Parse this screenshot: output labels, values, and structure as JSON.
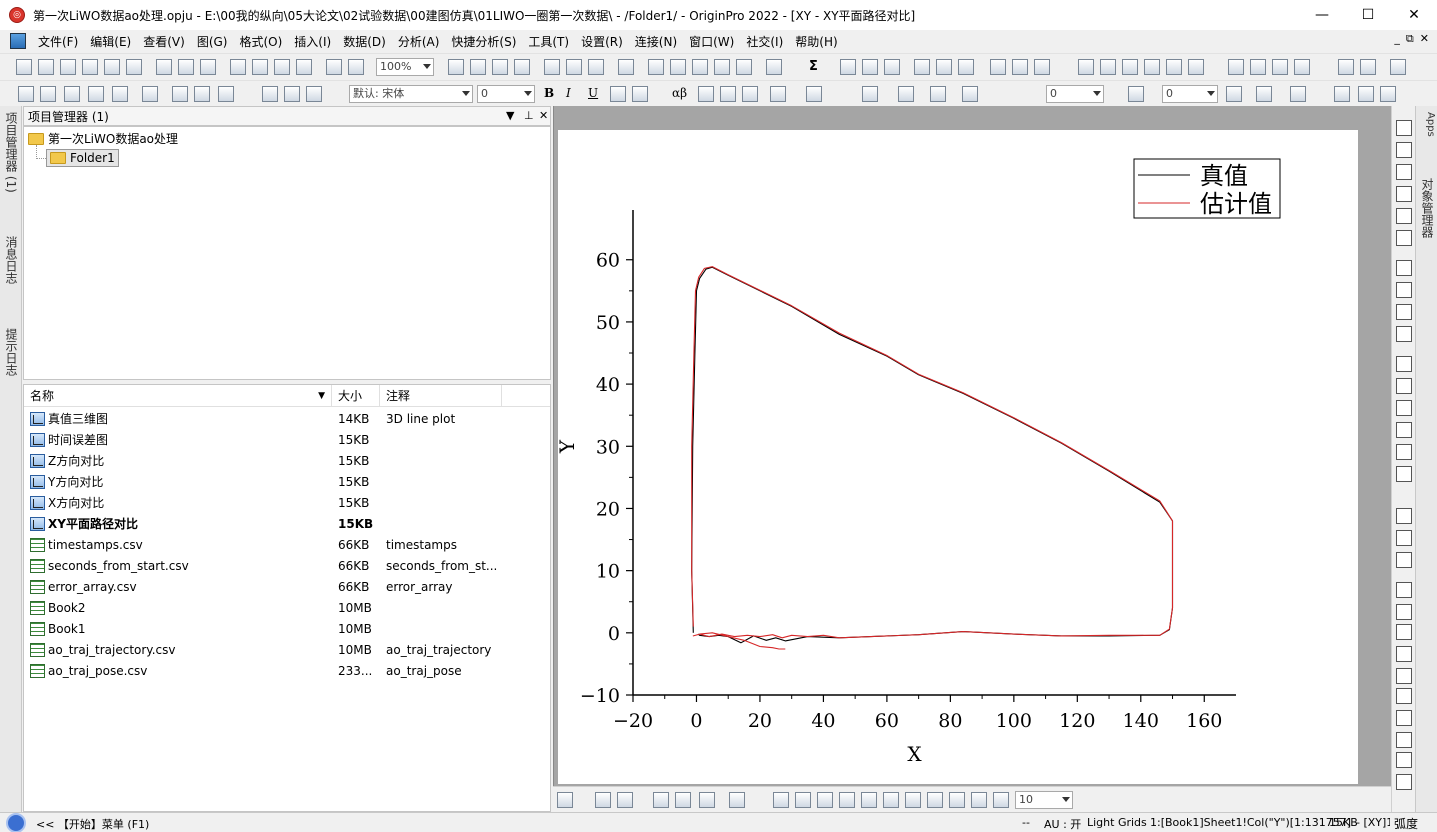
{
  "window": {
    "title": "第一次LiWO数据ao处理.opju - E:\\00我的纵向\\05大论文\\02试验数据\\00建图仿真\\01LIWO一圈第一次数据\\ - /Folder1/ - OriginPro 2022 - [XY - XY平面路径对比]",
    "minimize": "—",
    "maximize": "☐",
    "close": "✕"
  },
  "menubar": {
    "items": [
      "文件(F)",
      "编辑(E)",
      "查看(V)",
      "图(G)",
      "格式(O)",
      "插入(I)",
      "数据(D)",
      "分析(A)",
      "快捷分析(S)",
      "工具(T)",
      "设置(R)",
      "连接(N)",
      "窗口(W)",
      "社交(I)",
      "帮助(H)"
    ],
    "mdi_controls": [
      "_",
      "⧉",
      "✕"
    ]
  },
  "toolbar": {
    "zoom": "100%",
    "font": "默认: 宋体",
    "font_size": "0",
    "line_width": "0",
    "fill_size": "0",
    "bold": "B",
    "italic": "I",
    "underline": "U",
    "greek": "αβ",
    "sum_icon": "Σ"
  },
  "left_tabs": [
    "项目管理器 (1)",
    "消息日志",
    "提示日志"
  ],
  "project_manager": {
    "title": "项目管理器 (1)",
    "root": "第一次LiWO数据ao处理",
    "folder": "Folder1",
    "columns": [
      "名称",
      "大小",
      "注释"
    ],
    "items": [
      {
        "name": "真值三维图",
        "size": "14KB",
        "comment": "3D line plot",
        "type": "graph",
        "bold": false
      },
      {
        "name": "时间误差图",
        "size": "15KB",
        "comment": "",
        "type": "graph",
        "bold": false
      },
      {
        "name": "Z方向对比",
        "size": "15KB",
        "comment": "",
        "type": "graph",
        "bold": false
      },
      {
        "name": "Y方向对比",
        "size": "15KB",
        "comment": "",
        "type": "graph",
        "bold": false
      },
      {
        "name": "X方向对比",
        "size": "15KB",
        "comment": "",
        "type": "graph",
        "bold": false
      },
      {
        "name": "XY平面路径对比",
        "size": "15KB",
        "comment": "",
        "type": "graph",
        "bold": true
      },
      {
        "name": "timestamps.csv",
        "size": "66KB",
        "comment": "timestamps",
        "type": "book",
        "bold": false
      },
      {
        "name": "seconds_from_start.csv",
        "size": "66KB",
        "comment": "seconds_from_st...",
        "type": "book",
        "bold": false
      },
      {
        "name": "error_array.csv",
        "size": "66KB",
        "comment": "error_array",
        "type": "book",
        "bold": false
      },
      {
        "name": "Book2",
        "size": "10MB",
        "comment": "",
        "type": "book",
        "bold": false
      },
      {
        "name": "Book1",
        "size": "10MB",
        "comment": "",
        "type": "book",
        "bold": false
      },
      {
        "name": "ao_traj_trajectory.csv",
        "size": "10MB",
        "comment": "ao_traj_trajectory",
        "type": "book",
        "bold": false
      },
      {
        "name": "ao_traj_pose.csv",
        "size": "233...",
        "comment": "ao_traj_pose",
        "type": "book",
        "bold": false
      }
    ]
  },
  "right_tabs": [
    "Apps",
    "对象管理器"
  ],
  "bottom_toolbar": {
    "size_combo": "10"
  },
  "statusbar": {
    "start": "<< 【开始】菜单 (F1)",
    "dashes": "--",
    "au": "AU : 开",
    "grids": "Light Grids",
    "cell": "1:[Book1]Sheet1!Col(\"Y\")[1:131757]",
    "size": "15KB",
    "layer": "- [XY]1!1",
    "angle": "弧度"
  },
  "chart_data": {
    "type": "line",
    "title": "",
    "xlabel": "X",
    "ylabel": "Y",
    "xlim": [
      -20,
      170
    ],
    "ylim": [
      -10,
      68
    ],
    "xticks": [
      -20,
      0,
      20,
      40,
      60,
      80,
      100,
      120,
      140,
      160
    ],
    "yticks": [
      -10,
      0,
      10,
      20,
      30,
      40,
      50,
      60
    ],
    "xtick_labels": [
      "−20",
      "0",
      "20",
      "40",
      "60",
      "80",
      "100",
      "120",
      "140",
      "160"
    ],
    "ytick_labels": [
      "−10",
      "0",
      "10",
      "20",
      "30",
      "40",
      "50",
      "60"
    ],
    "legend": "top-right",
    "grid": false,
    "series": [
      {
        "name": "真值",
        "color": "#000000",
        "x": [
          -1,
          -1.5,
          -1.2,
          -0.5,
          0,
          1,
          3,
          5,
          10,
          20,
          30,
          45,
          60,
          70,
          84,
          100,
          115,
          130,
          146,
          148,
          150,
          150,
          149,
          146,
          130,
          115,
          100,
          84,
          70,
          55,
          45,
          35,
          28,
          25,
          22,
          18,
          14,
          10,
          7,
          4,
          1,
          0.5
        ],
        "y": [
          0,
          10,
          30,
          45,
          55,
          57,
          58.5,
          58.8,
          57.5,
          55,
          52.5,
          48,
          44.5,
          41.5,
          38.5,
          34.5,
          30.5,
          26,
          21,
          19.5,
          18,
          4,
          0.5,
          -0.4,
          -0.5,
          -0.5,
          -0.2,
          0.2,
          -0.3,
          -0.6,
          -0.8,
          -0.6,
          -1.3,
          -0.8,
          -1.2,
          -0.5,
          -1.6,
          -0.6,
          -0.4,
          -0.6,
          -0.4,
          -0.2
        ]
      },
      {
        "name": "估计值",
        "color": "#d62728",
        "x": [
          -1,
          -1.5,
          -1.5,
          -0.8,
          -0.3,
          0.7,
          2.5,
          5,
          10,
          20,
          30,
          45,
          60,
          70,
          84,
          100,
          115,
          130,
          146,
          148,
          150,
          150,
          149,
          146,
          130,
          115,
          100,
          84,
          70,
          55,
          45,
          40,
          35,
          30,
          27,
          24,
          20,
          16,
          12,
          8,
          4,
          1,
          -1,
          1,
          5,
          10,
          15,
          20,
          24,
          26,
          28
        ],
        "y": [
          1,
          10,
          30,
          45,
          55,
          57.2,
          58.6,
          58.9,
          57.6,
          55.1,
          52.6,
          48.2,
          44.6,
          41.6,
          38.6,
          34.6,
          30.6,
          26.1,
          21.2,
          19.6,
          18,
          4,
          0.6,
          -0.4,
          -0.4,
          -0.5,
          -0.2,
          0.2,
          -0.3,
          -0.6,
          -0.8,
          -0.4,
          -0.6,
          -0.4,
          -0.8,
          -0.3,
          -0.6,
          -0.4,
          -0.6,
          -0.2,
          -0.6,
          -0.2,
          -0.5,
          -0.2,
          0,
          -0.6,
          -1.2,
          -2.2,
          -2.4,
          -2.6,
          -2.6
        ]
      }
    ]
  }
}
